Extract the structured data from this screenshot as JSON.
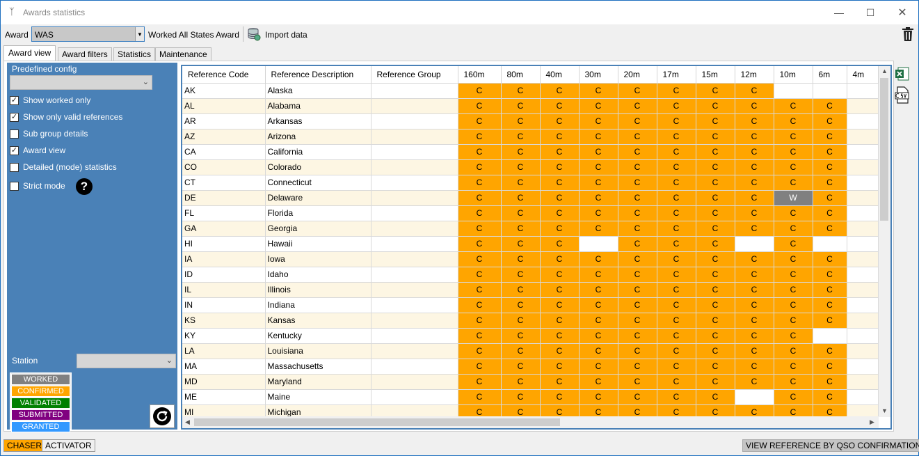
{
  "window": {
    "title": "Awards statistics"
  },
  "toolbar": {
    "award_label": "Award",
    "award_value": "WAS",
    "award_name": "Worked All States Award",
    "import_label": "Import data"
  },
  "tabs": [
    {
      "label": "Award view",
      "active": true
    },
    {
      "label": "Award filters",
      "active": false
    },
    {
      "label": "Statistics",
      "active": false
    },
    {
      "label": "Maintenance",
      "active": false
    }
  ],
  "left_panel": {
    "predefined_label": "Predefined config",
    "predefined_value": "",
    "options": [
      {
        "label": "Show worked only",
        "checked": true
      },
      {
        "label": "Show only valid references",
        "checked": true
      },
      {
        "label": "Sub group details",
        "checked": false
      },
      {
        "label": "Award view",
        "checked": true
      },
      {
        "label": "Detailed (mode) statistics",
        "checked": false
      },
      {
        "label": "Strict mode",
        "checked": false
      }
    ],
    "station_label": "Station",
    "station_value": "",
    "legend": [
      {
        "label": "WORKED",
        "color": "#808080"
      },
      {
        "label": "CONFIRMED",
        "color": "#ffa500"
      },
      {
        "label": "VALIDATED",
        "color": "#008000"
      },
      {
        "label": "SUBMITTED",
        "color": "#800080"
      },
      {
        "label": "GRANTED",
        "color": "#3399ff"
      }
    ]
  },
  "grid": {
    "columns": [
      "Reference Code",
      "Reference Description",
      "Reference Group",
      "160m",
      "80m",
      "40m",
      "30m",
      "20m",
      "17m",
      "15m",
      "12m",
      "10m",
      "6m",
      "4m"
    ],
    "rows": [
      {
        "code": "AK",
        "desc": "Alaska",
        "group": "",
        "bands": [
          "C",
          "C",
          "C",
          "C",
          "C",
          "C",
          "C",
          "C",
          "",
          "",
          ""
        ]
      },
      {
        "code": "AL",
        "desc": "Alabama",
        "group": "",
        "bands": [
          "C",
          "C",
          "C",
          "C",
          "C",
          "C",
          "C",
          "C",
          "C",
          "C",
          ""
        ]
      },
      {
        "code": "AR",
        "desc": "Arkansas",
        "group": "",
        "bands": [
          "C",
          "C",
          "C",
          "C",
          "C",
          "C",
          "C",
          "C",
          "C",
          "C",
          ""
        ]
      },
      {
        "code": "AZ",
        "desc": "Arizona",
        "group": "",
        "bands": [
          "C",
          "C",
          "C",
          "C",
          "C",
          "C",
          "C",
          "C",
          "C",
          "C",
          ""
        ]
      },
      {
        "code": "CA",
        "desc": "California",
        "group": "",
        "bands": [
          "C",
          "C",
          "C",
          "C",
          "C",
          "C",
          "C",
          "C",
          "C",
          "C",
          ""
        ]
      },
      {
        "code": "CO",
        "desc": "Colorado",
        "group": "",
        "bands": [
          "C",
          "C",
          "C",
          "C",
          "C",
          "C",
          "C",
          "C",
          "C",
          "C",
          ""
        ]
      },
      {
        "code": "CT",
        "desc": "Connecticut",
        "group": "",
        "bands": [
          "C",
          "C",
          "C",
          "C",
          "C",
          "C",
          "C",
          "C",
          "C",
          "C",
          ""
        ]
      },
      {
        "code": "DE",
        "desc": "Delaware",
        "group": "",
        "bands": [
          "C",
          "C",
          "C",
          "C",
          "C",
          "C",
          "C",
          "C",
          "W",
          "C",
          ""
        ]
      },
      {
        "code": "FL",
        "desc": "Florida",
        "group": "",
        "bands": [
          "C",
          "C",
          "C",
          "C",
          "C",
          "C",
          "C",
          "C",
          "C",
          "C",
          ""
        ]
      },
      {
        "code": "GA",
        "desc": "Georgia",
        "group": "",
        "bands": [
          "C",
          "C",
          "C",
          "C",
          "C",
          "C",
          "C",
          "C",
          "C",
          "C",
          ""
        ]
      },
      {
        "code": "HI",
        "desc": "Hawaii",
        "group": "",
        "bands": [
          "C",
          "C",
          "C",
          "",
          "C",
          "C",
          "C",
          "",
          "C",
          "",
          ""
        ]
      },
      {
        "code": "IA",
        "desc": "Iowa",
        "group": "",
        "bands": [
          "C",
          "C",
          "C",
          "C",
          "C",
          "C",
          "C",
          "C",
          "C",
          "C",
          ""
        ]
      },
      {
        "code": "ID",
        "desc": "Idaho",
        "group": "",
        "bands": [
          "C",
          "C",
          "C",
          "C",
          "C",
          "C",
          "C",
          "C",
          "C",
          "C",
          ""
        ]
      },
      {
        "code": "IL",
        "desc": "Illinois",
        "group": "",
        "bands": [
          "C",
          "C",
          "C",
          "C",
          "C",
          "C",
          "C",
          "C",
          "C",
          "C",
          ""
        ]
      },
      {
        "code": "IN",
        "desc": "Indiana",
        "group": "",
        "bands": [
          "C",
          "C",
          "C",
          "C",
          "C",
          "C",
          "C",
          "C",
          "C",
          "C",
          ""
        ]
      },
      {
        "code": "KS",
        "desc": "Kansas",
        "group": "",
        "bands": [
          "C",
          "C",
          "C",
          "C",
          "C",
          "C",
          "C",
          "C",
          "C",
          "C",
          ""
        ]
      },
      {
        "code": "KY",
        "desc": "Kentucky",
        "group": "",
        "bands": [
          "C",
          "C",
          "C",
          "C",
          "C",
          "C",
          "C",
          "C",
          "C",
          "",
          ""
        ]
      },
      {
        "code": "LA",
        "desc": "Louisiana",
        "group": "",
        "bands": [
          "C",
          "C",
          "C",
          "C",
          "C",
          "C",
          "C",
          "C",
          "C",
          "C",
          ""
        ]
      },
      {
        "code": "MA",
        "desc": "Massachusetts",
        "group": "",
        "bands": [
          "C",
          "C",
          "C",
          "C",
          "C",
          "C",
          "C",
          "C",
          "C",
          "C",
          ""
        ]
      },
      {
        "code": "MD",
        "desc": "Maryland",
        "group": "",
        "bands": [
          "C",
          "C",
          "C",
          "C",
          "C",
          "C",
          "C",
          "C",
          "C",
          "C",
          ""
        ]
      },
      {
        "code": "ME",
        "desc": "Maine",
        "group": "",
        "bands": [
          "C",
          "C",
          "C",
          "C",
          "C",
          "C",
          "C",
          "",
          "C",
          "C",
          ""
        ]
      },
      {
        "code": "MI",
        "desc": "Michigan",
        "group": "",
        "bands": [
          "C",
          "C",
          "C",
          "C",
          "C",
          "C",
          "C",
          "C",
          "C",
          "C",
          ""
        ]
      }
    ]
  },
  "status": {
    "chaser_label": "CHASER",
    "activator_label": "ACTIVATOR",
    "view_label": "VIEW REFERENCE BY QSO CONFIRMATION"
  },
  "colors": {
    "confirmed": "#ffa500",
    "worked": "#808080",
    "panel": "#4a81b7"
  }
}
